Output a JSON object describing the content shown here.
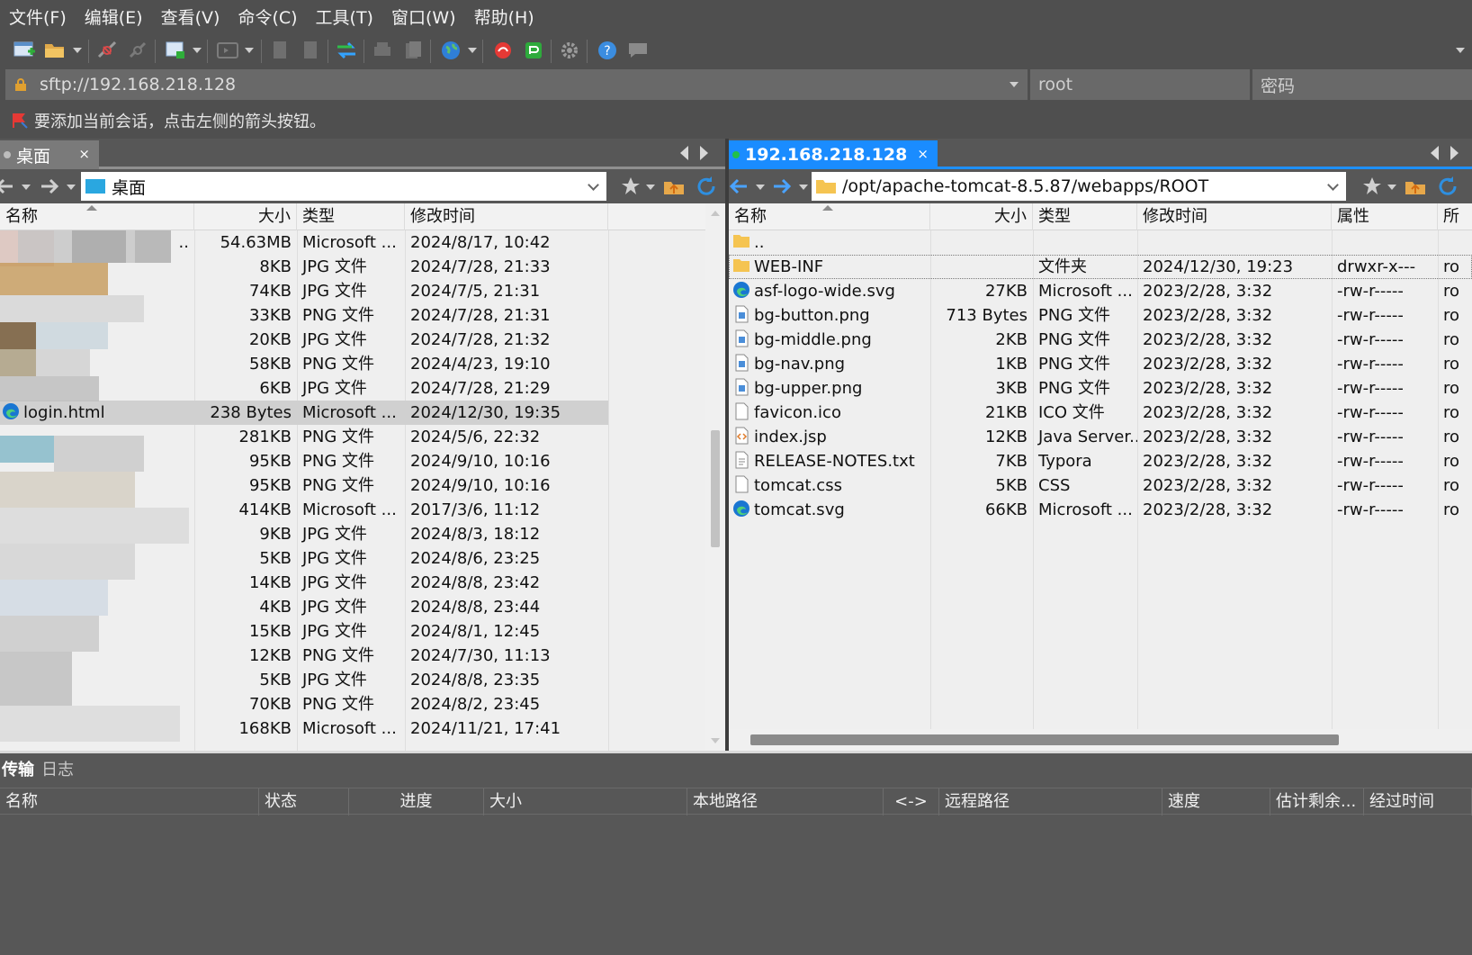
{
  "menu": [
    "文件(F)",
    "编辑(E)",
    "查看(V)",
    "命令(C)",
    "工具(T)",
    "窗口(W)",
    "帮助(H)"
  ],
  "address": {
    "host_value": "sftp://192.168.218.128",
    "user_placeholder": "root",
    "password_placeholder": "密码"
  },
  "info_text": "要添加当前会话，点击左侧的箭头按钮。",
  "left_pane": {
    "tab_label": "桌面",
    "tab_close": "×",
    "path": "桌面",
    "columns": [
      "名称",
      "大小",
      "类型",
      "修改时间"
    ],
    "files": [
      {
        "name": "..",
        "size": "54.63MB",
        "type": "Microsoft ...",
        "modified": "2024/8/17, 10:42"
      },
      {
        "name": "",
        "size": "8KB",
        "type": "JPG 文件",
        "modified": "2024/7/28, 21:33"
      },
      {
        "name": "",
        "size": "74KB",
        "type": "JPG 文件",
        "modified": "2024/7/5, 21:31"
      },
      {
        "name": "",
        "size": "33KB",
        "type": "PNG 文件",
        "modified": "2024/7/28, 21:31"
      },
      {
        "name": "",
        "size": "20KB",
        "type": "JPG 文件",
        "modified": "2024/7/28, 21:32"
      },
      {
        "name": "",
        "size": "58KB",
        "type": "PNG 文件",
        "modified": "2024/4/23, 19:10"
      },
      {
        "name": "",
        "size": "6KB",
        "type": "JPG 文件",
        "modified": "2024/7/28, 21:29"
      },
      {
        "name": "login.html",
        "size": "238 Bytes",
        "type": "Microsoft ...",
        "modified": "2024/12/30, 19:35"
      },
      {
        "name": "",
        "size": "281KB",
        "type": "PNG 文件",
        "modified": "2024/5/6, 22:32"
      },
      {
        "name": "",
        "size": "95KB",
        "type": "PNG 文件",
        "modified": "2024/9/10, 10:16"
      },
      {
        "name": "",
        "size": "95KB",
        "type": "PNG 文件",
        "modified": "2024/9/10, 10:16"
      },
      {
        "name": "",
        "size": "414KB",
        "type": "Microsoft ...",
        "modified": "2017/3/6, 11:12"
      },
      {
        "name": "",
        "size": "9KB",
        "type": "JPG 文件",
        "modified": "2024/8/3, 18:12"
      },
      {
        "name": "",
        "size": "5KB",
        "type": "JPG 文件",
        "modified": "2024/8/6, 23:25"
      },
      {
        "name": "",
        "size": "14KB",
        "type": "JPG 文件",
        "modified": "2024/8/8, 23:42"
      },
      {
        "name": "",
        "size": "4KB",
        "type": "JPG 文件",
        "modified": "2024/8/8, 23:44"
      },
      {
        "name": "",
        "size": "15KB",
        "type": "JPG 文件",
        "modified": "2024/8/1, 12:45"
      },
      {
        "name": "",
        "size": "12KB",
        "type": "PNG 文件",
        "modified": "2024/7/30, 11:13"
      },
      {
        "name": "",
        "size": "5KB",
        "type": "JPG 文件",
        "modified": "2024/8/8, 23:35"
      },
      {
        "name": "",
        "size": "70KB",
        "type": "PNG 文件",
        "modified": "2024/8/2, 23:45"
      },
      {
        "name": "",
        "size": "168KB",
        "type": "Microsoft ...",
        "modified": "2024/11/21, 17:41"
      }
    ]
  },
  "right_pane": {
    "tab_label": "192.168.218.128",
    "tab_close": "×",
    "path": "/opt/apache-tomcat-8.5.87/webapps/ROOT",
    "columns": [
      "名称",
      "大小",
      "类型",
      "修改时间",
      "属性",
      "所"
    ],
    "files": [
      {
        "name": "..",
        "size": "",
        "type": "",
        "modified": "",
        "attr": "",
        "owner": "",
        "icon": "folder-icon"
      },
      {
        "name": "WEB-INF",
        "size": "",
        "type": "文件夹",
        "modified": "2024/12/30, 19:23",
        "attr": "drwxr-x---",
        "owner": "ro",
        "icon": "folder-icon"
      },
      {
        "name": "asf-logo-wide.svg",
        "size": "27KB",
        "type": "Microsoft ...",
        "modified": "2023/2/28, 3:32",
        "attr": "-rw-r-----",
        "owner": "ro",
        "icon": "edge-icon"
      },
      {
        "name": "bg-button.png",
        "size": "713 Bytes",
        "type": "PNG 文件",
        "modified": "2023/2/28, 3:32",
        "attr": "-rw-r-----",
        "owner": "ro",
        "icon": "image-file-icon"
      },
      {
        "name": "bg-middle.png",
        "size": "2KB",
        "type": "PNG 文件",
        "modified": "2023/2/28, 3:32",
        "attr": "-rw-r-----",
        "owner": "ro",
        "icon": "image-file-icon"
      },
      {
        "name": "bg-nav.png",
        "size": "1KB",
        "type": "PNG 文件",
        "modified": "2023/2/28, 3:32",
        "attr": "-rw-r-----",
        "owner": "ro",
        "icon": "image-file-icon"
      },
      {
        "name": "bg-upper.png",
        "size": "3KB",
        "type": "PNG 文件",
        "modified": "2023/2/28, 3:32",
        "attr": "-rw-r-----",
        "owner": "ro",
        "icon": "image-file-icon"
      },
      {
        "name": "favicon.ico",
        "size": "21KB",
        "type": "ICO 文件",
        "modified": "2023/2/28, 3:32",
        "attr": "-rw-r-----",
        "owner": "ro",
        "icon": "blank-file-icon"
      },
      {
        "name": "index.jsp",
        "size": "12KB",
        "type": "Java Server...",
        "modified": "2023/2/28, 3:32",
        "attr": "-rw-r-----",
        "owner": "ro",
        "icon": "code-file-icon"
      },
      {
        "name": "RELEASE-NOTES.txt",
        "size": "7KB",
        "type": "Typora",
        "modified": "2023/2/28, 3:32",
        "attr": "-rw-r-----",
        "owner": "ro",
        "icon": "text-file-icon"
      },
      {
        "name": "tomcat.css",
        "size": "5KB",
        "type": "CSS",
        "modified": "2023/2/28, 3:32",
        "attr": "-rw-r-----",
        "owner": "ro",
        "icon": "blank-file-icon"
      },
      {
        "name": "tomcat.svg",
        "size": "66KB",
        "type": "Microsoft ...",
        "modified": "2023/2/28, 3:32",
        "attr": "-rw-r-----",
        "owner": "ro",
        "icon": "edge-icon"
      }
    ]
  },
  "queue": {
    "tabs": [
      "传输",
      "日志"
    ],
    "columns": [
      "名称",
      "状态",
      "进度",
      "大小",
      "本地路径",
      "<->",
      "远程路径",
      "速度",
      "估计剩余...",
      "经过时间"
    ]
  },
  "colors": {
    "accent_tab": "#1a8cff",
    "selected_row": "#d0d0d0",
    "chrome": "#4f4f4f"
  }
}
